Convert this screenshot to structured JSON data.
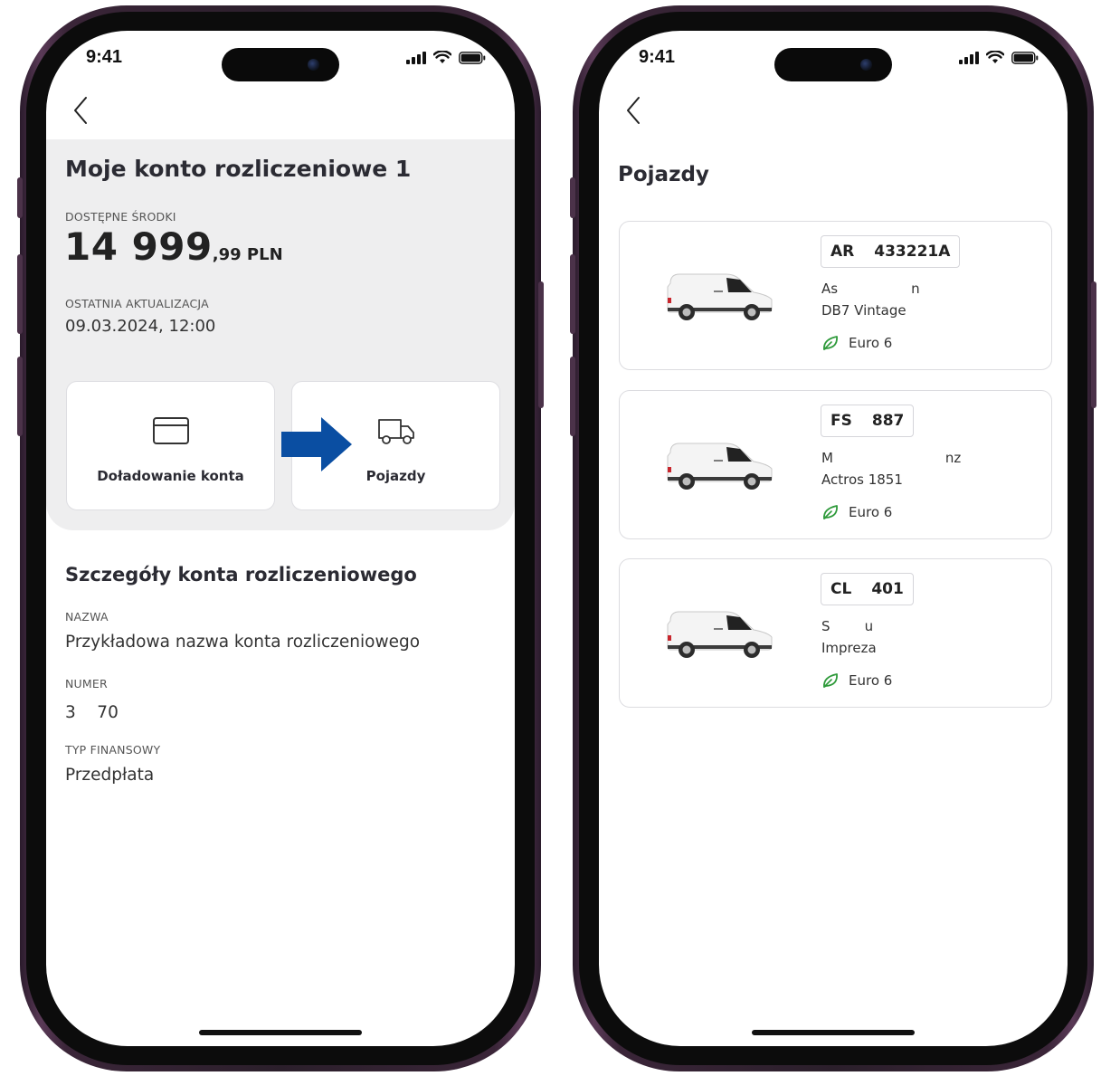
{
  "status": {
    "time": "9:41"
  },
  "account_screen": {
    "title": "Moje konto rozliczeniowe 1",
    "available_label": "DOSTĘPNE ŚRODKI",
    "balance_main": "14 999",
    "balance_fraction": ",99 PLN",
    "last_update_label": "OSTATNIA AKTUALIZACJA",
    "last_update_value": "09.03.2024, 12:00",
    "tiles": [
      {
        "label": "Doładowanie konta",
        "icon": "credit-card-icon"
      },
      {
        "label": "Pojazdy",
        "icon": "truck-icon"
      }
    ],
    "details_title": "Szczegóły konta rozliczeniowego",
    "name_label": "NAZWA",
    "name_value": "Przykładowa nazwa konta rozliczeniowego",
    "number_label": "NUMER",
    "number_value": "3    70",
    "type_label": "TYP FINANSOWY",
    "type_value": "Przedpłata",
    "highlight_arrow_color": "#0a4ea2"
  },
  "vehicles_screen": {
    "title": "Pojazdy",
    "vehicles": [
      {
        "plate_prefix": "AR",
        "plate_number": "433221A",
        "make": "As                 n",
        "model": "DB7 Vintage",
        "emission": "Euro 6"
      },
      {
        "plate_prefix": "FS",
        "plate_number": "887",
        "make": "M                          nz",
        "model": "Actros 1851",
        "emission": "Euro 6"
      },
      {
        "plate_prefix": "CL",
        "plate_number": "401",
        "make": "S        u",
        "model": "Impreza",
        "emission": "Euro 6"
      }
    ],
    "eco_color": "#2e9a3a"
  }
}
